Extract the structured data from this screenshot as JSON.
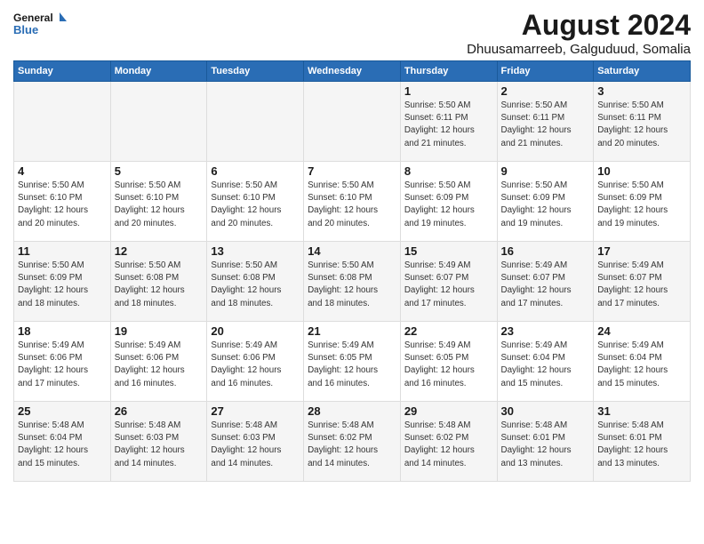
{
  "header": {
    "logo_line1": "General",
    "logo_line2": "Blue",
    "title": "August 2024",
    "subtitle": "Dhuusamarreeb, Galguduud, Somalia"
  },
  "weekdays": [
    "Sunday",
    "Monday",
    "Tuesday",
    "Wednesday",
    "Thursday",
    "Friday",
    "Saturday"
  ],
  "weeks": [
    [
      {
        "day": "",
        "info": ""
      },
      {
        "day": "",
        "info": ""
      },
      {
        "day": "",
        "info": ""
      },
      {
        "day": "",
        "info": ""
      },
      {
        "day": "1",
        "info": "Sunrise: 5:50 AM\nSunset: 6:11 PM\nDaylight: 12 hours\nand 21 minutes."
      },
      {
        "day": "2",
        "info": "Sunrise: 5:50 AM\nSunset: 6:11 PM\nDaylight: 12 hours\nand 21 minutes."
      },
      {
        "day": "3",
        "info": "Sunrise: 5:50 AM\nSunset: 6:11 PM\nDaylight: 12 hours\nand 20 minutes."
      }
    ],
    [
      {
        "day": "4",
        "info": "Sunrise: 5:50 AM\nSunset: 6:10 PM\nDaylight: 12 hours\nand 20 minutes."
      },
      {
        "day": "5",
        "info": "Sunrise: 5:50 AM\nSunset: 6:10 PM\nDaylight: 12 hours\nand 20 minutes."
      },
      {
        "day": "6",
        "info": "Sunrise: 5:50 AM\nSunset: 6:10 PM\nDaylight: 12 hours\nand 20 minutes."
      },
      {
        "day": "7",
        "info": "Sunrise: 5:50 AM\nSunset: 6:10 PM\nDaylight: 12 hours\nand 20 minutes."
      },
      {
        "day": "8",
        "info": "Sunrise: 5:50 AM\nSunset: 6:09 PM\nDaylight: 12 hours\nand 19 minutes."
      },
      {
        "day": "9",
        "info": "Sunrise: 5:50 AM\nSunset: 6:09 PM\nDaylight: 12 hours\nand 19 minutes."
      },
      {
        "day": "10",
        "info": "Sunrise: 5:50 AM\nSunset: 6:09 PM\nDaylight: 12 hours\nand 19 minutes."
      }
    ],
    [
      {
        "day": "11",
        "info": "Sunrise: 5:50 AM\nSunset: 6:09 PM\nDaylight: 12 hours\nand 18 minutes."
      },
      {
        "day": "12",
        "info": "Sunrise: 5:50 AM\nSunset: 6:08 PM\nDaylight: 12 hours\nand 18 minutes."
      },
      {
        "day": "13",
        "info": "Sunrise: 5:50 AM\nSunset: 6:08 PM\nDaylight: 12 hours\nand 18 minutes."
      },
      {
        "day": "14",
        "info": "Sunrise: 5:50 AM\nSunset: 6:08 PM\nDaylight: 12 hours\nand 18 minutes."
      },
      {
        "day": "15",
        "info": "Sunrise: 5:49 AM\nSunset: 6:07 PM\nDaylight: 12 hours\nand 17 minutes."
      },
      {
        "day": "16",
        "info": "Sunrise: 5:49 AM\nSunset: 6:07 PM\nDaylight: 12 hours\nand 17 minutes."
      },
      {
        "day": "17",
        "info": "Sunrise: 5:49 AM\nSunset: 6:07 PM\nDaylight: 12 hours\nand 17 minutes."
      }
    ],
    [
      {
        "day": "18",
        "info": "Sunrise: 5:49 AM\nSunset: 6:06 PM\nDaylight: 12 hours\nand 17 minutes."
      },
      {
        "day": "19",
        "info": "Sunrise: 5:49 AM\nSunset: 6:06 PM\nDaylight: 12 hours\nand 16 minutes."
      },
      {
        "day": "20",
        "info": "Sunrise: 5:49 AM\nSunset: 6:06 PM\nDaylight: 12 hours\nand 16 minutes."
      },
      {
        "day": "21",
        "info": "Sunrise: 5:49 AM\nSunset: 6:05 PM\nDaylight: 12 hours\nand 16 minutes."
      },
      {
        "day": "22",
        "info": "Sunrise: 5:49 AM\nSunset: 6:05 PM\nDaylight: 12 hours\nand 16 minutes."
      },
      {
        "day": "23",
        "info": "Sunrise: 5:49 AM\nSunset: 6:04 PM\nDaylight: 12 hours\nand 15 minutes."
      },
      {
        "day": "24",
        "info": "Sunrise: 5:49 AM\nSunset: 6:04 PM\nDaylight: 12 hours\nand 15 minutes."
      }
    ],
    [
      {
        "day": "25",
        "info": "Sunrise: 5:48 AM\nSunset: 6:04 PM\nDaylight: 12 hours\nand 15 minutes."
      },
      {
        "day": "26",
        "info": "Sunrise: 5:48 AM\nSunset: 6:03 PM\nDaylight: 12 hours\nand 14 minutes."
      },
      {
        "day": "27",
        "info": "Sunrise: 5:48 AM\nSunset: 6:03 PM\nDaylight: 12 hours\nand 14 minutes."
      },
      {
        "day": "28",
        "info": "Sunrise: 5:48 AM\nSunset: 6:02 PM\nDaylight: 12 hours\nand 14 minutes."
      },
      {
        "day": "29",
        "info": "Sunrise: 5:48 AM\nSunset: 6:02 PM\nDaylight: 12 hours\nand 14 minutes."
      },
      {
        "day": "30",
        "info": "Sunrise: 5:48 AM\nSunset: 6:01 PM\nDaylight: 12 hours\nand 13 minutes."
      },
      {
        "day": "31",
        "info": "Sunrise: 5:48 AM\nSunset: 6:01 PM\nDaylight: 12 hours\nand 13 minutes."
      }
    ]
  ]
}
